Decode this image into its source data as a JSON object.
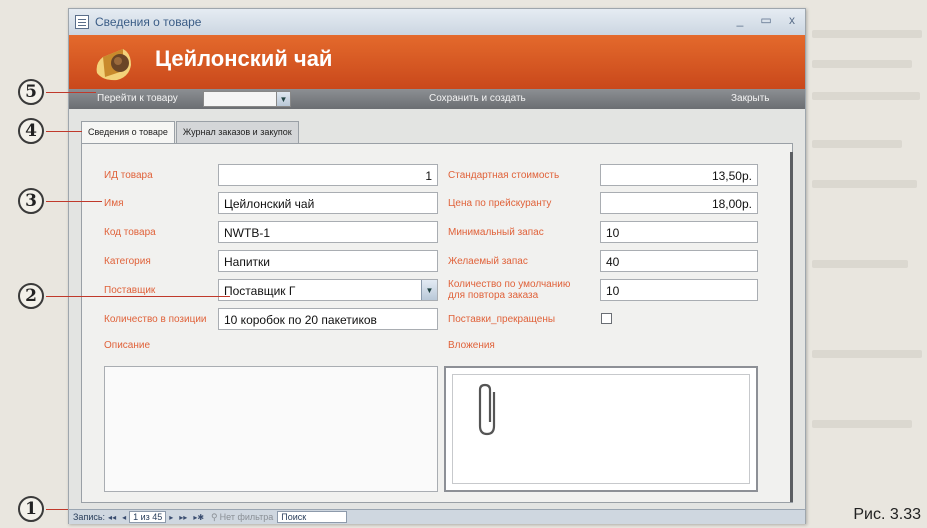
{
  "window": {
    "title": "Сведения о товаре",
    "minimize": "_",
    "restore": "▭",
    "close": "x"
  },
  "banner": {
    "title": "Цейлонский чай"
  },
  "toolbar": {
    "goto_label": "Перейти к товару",
    "goto_value": "",
    "save_label": "Сохранить и создать",
    "close_label": "Закрыть"
  },
  "tabs": [
    {
      "label": "Сведения о товаре",
      "active": true
    },
    {
      "label": "Журнал заказов и закупок",
      "active": false
    }
  ],
  "fields": {
    "product_id": {
      "label": "ИД товара",
      "value": "1"
    },
    "name": {
      "label": "Имя",
      "value": "Цейлонский чай"
    },
    "product_code": {
      "label": "Код товара",
      "value": "NWTB-1"
    },
    "category": {
      "label": "Категория",
      "value": "Напитки"
    },
    "supplier": {
      "label": "Поставщик",
      "value": "Поставщик Г"
    },
    "qty_per_unit": {
      "label": "Количество в позиции",
      "value": "10 коробок по 20 пакетиков"
    },
    "standard_cost": {
      "label": "Стандартная стоимость",
      "value": "13,50р."
    },
    "list_price": {
      "label": "Цена по прейскуранту",
      "value": "18,00р."
    },
    "min_stock": {
      "label": "Минимальный запас",
      "value": "10"
    },
    "target_stock": {
      "label": "Желаемый запас",
      "value": "40"
    },
    "reorder_qty": {
      "label": "Количество по умолчанию для повтора заказа",
      "value": "10"
    },
    "discontinued": {
      "label": "Поставки_прекращены",
      "checked": false
    },
    "description": {
      "label": "Описание"
    },
    "attachments": {
      "label": "Вложения"
    }
  },
  "statusbar": {
    "record_label": "Запись:",
    "first": "◂◂",
    "prev": "◂",
    "position": "1 из 45",
    "next": "▸",
    "last": "▸▸",
    "new": "▸✱",
    "filter": "Нет фильтра",
    "search": "Поиск"
  },
  "callouts": [
    "5",
    "4",
    "3",
    "2",
    "1"
  ],
  "caption": "Рис. 3.33",
  "colors": {
    "banner": "#d4531f",
    "label": "#e0623a",
    "toolbar": "#7c7f83"
  }
}
